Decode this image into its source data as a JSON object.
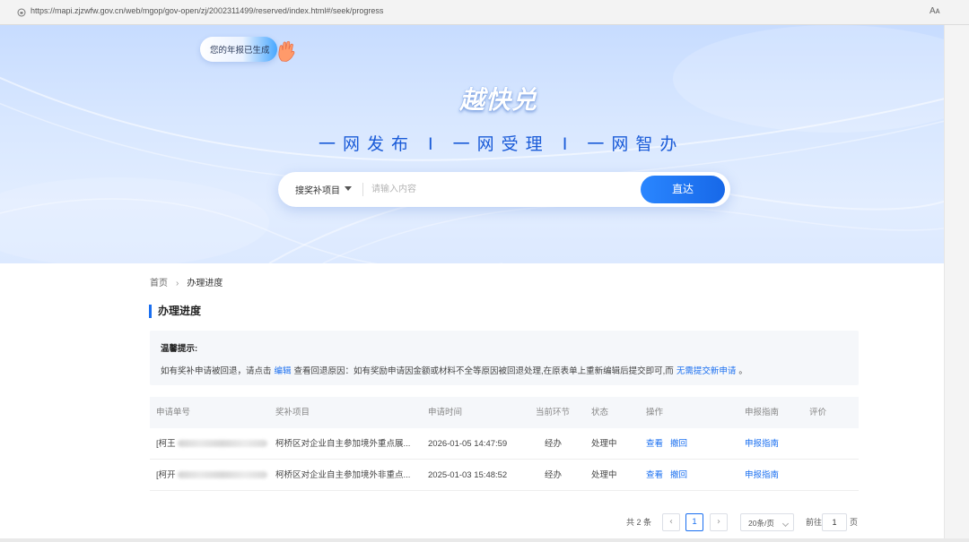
{
  "browser": {
    "url": "https://mapi.zjzwfw.gov.cn/web/mgop/gov-open/zj/2002311499/reserved/index.html#/seek/progress",
    "reader_label": "Aᴀ"
  },
  "hero": {
    "report_pill": "您的年报已生成",
    "brand": "越快兑",
    "slogan": "一网发布  Ⅰ  一网受理  Ⅰ  一网智办",
    "search": {
      "category": "搜奖补项目",
      "placeholder": "请输入内容",
      "button": "直达"
    }
  },
  "breadcrumb": {
    "home": "首页",
    "current": "办理进度"
  },
  "section_title": "办理进度",
  "tip": {
    "title": "温馨提示:",
    "text_1": "如有奖补申请被回退，请点击",
    "link_edit": "编辑",
    "text_2": "查看回退原因：如有奖励申请因金额或材料不全等原因被回退处理,在原表单上重新编辑后提交即可,而",
    "link_new": "无需提交新申请",
    "text_3": "。"
  },
  "table": {
    "headers": {
      "no": "申请单号",
      "project": "奖补项目",
      "time": "申请时间",
      "step": "当前环节",
      "status": "状态",
      "ops": "操作",
      "guide": "申报指南",
      "rate": "评价"
    },
    "rows": [
      {
        "no": "[柯王",
        "project": "柯桥区对企业自主参加境外重点展...",
        "time": "2026-01-05 14:47:59",
        "step": "经办",
        "status": "处理中",
        "view": "查看",
        "withdraw": "撤回",
        "guide": "申报指南"
      },
      {
        "no": "[柯开",
        "project": "柯桥区对企业自主参加境外非重点...",
        "time": "2025-01-03 15:48:52",
        "step": "经办",
        "status": "处理中",
        "view": "查看",
        "withdraw": "撤回",
        "guide": "申报指南"
      }
    ]
  },
  "pagination": {
    "total": "共 2 条",
    "prev": "‹",
    "page": "1",
    "next": "›",
    "page_size": "20条/页",
    "goto_label": "前往",
    "goto_value": "1",
    "page_word": "页"
  }
}
